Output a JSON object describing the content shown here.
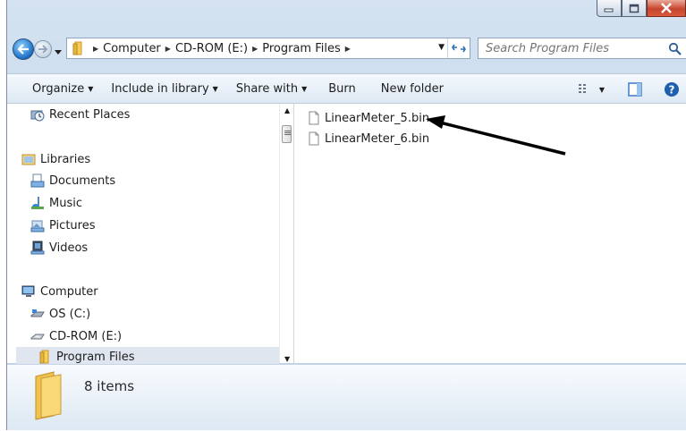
{
  "address": {
    "crumbs": [
      "Computer",
      "CD-ROM (E:)",
      "Program Files"
    ]
  },
  "search": {
    "placeholder": "Search Program Files"
  },
  "toolbar": {
    "organize": "Organize",
    "include": "Include in library",
    "share": "Share with",
    "burn": "Burn",
    "new_folder": "New folder"
  },
  "nav": {
    "recent": "Recent Places",
    "libraries": "Libraries",
    "documents": "Documents",
    "music": "Music",
    "pictures": "Pictures",
    "videos": "Videos",
    "computer": "Computer",
    "os": "OS (C:)",
    "cdrom": "CD-ROM (E:)",
    "program_files": "Program Files"
  },
  "files": [
    "LinearMeter_5.bin",
    "LinearMeter_6.bin"
  ],
  "details": {
    "count": "8 items"
  },
  "colors": {
    "accent": "#1c6fc4",
    "close": "#c7452e"
  }
}
